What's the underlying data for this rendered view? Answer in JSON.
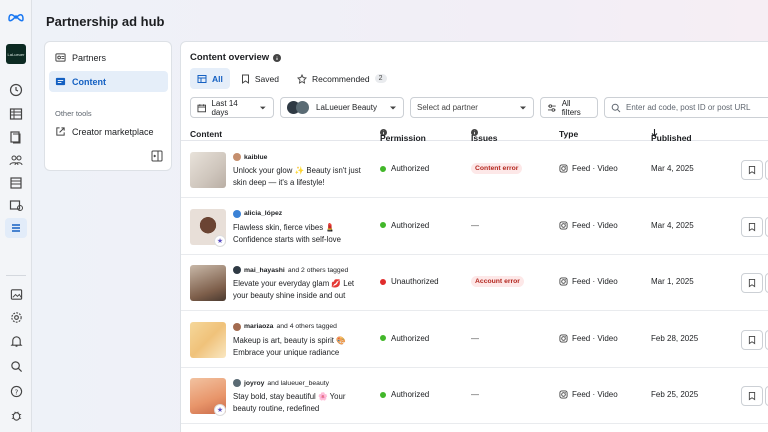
{
  "app": {
    "title": "Partnership ad hub",
    "brand_label": "LaLueuer"
  },
  "rail": {
    "icons": [
      "meta-logo",
      "brand-avatar",
      "dashboard-icon",
      "table-icon",
      "pages-icon",
      "people-icon",
      "catalog-icon",
      "ads-icon",
      "menu-icon",
      "image-icon",
      "settings-icon",
      "bell-icon",
      "search-icon",
      "help-icon",
      "bug-icon"
    ],
    "active": "menu-icon"
  },
  "left_panel": {
    "items": [
      {
        "label": "Partners",
        "icon": "partners-icon"
      },
      {
        "label": "Content",
        "icon": "content-icon",
        "active": true
      }
    ],
    "other_tools_label": "Other tools",
    "other_tools": [
      {
        "label": "Creator marketplace",
        "icon": "external-link-icon"
      }
    ]
  },
  "content": {
    "title": "Content overview",
    "tabs": [
      {
        "label": "All",
        "active": true
      },
      {
        "label": "Saved"
      },
      {
        "label": "Recommended",
        "count": "2"
      }
    ],
    "filters": {
      "date": "Last 14 days",
      "account": "LaLueuer Beauty",
      "partner_placeholder": "Select ad partner",
      "all_filters": "All filters",
      "search_placeholder": "Enter ad code, post ID or post URL"
    },
    "columns": {
      "content": "Content",
      "permission": "Permission",
      "issues": "Issues",
      "type": "Type",
      "published": "Published"
    },
    "rows": [
      {
        "author": "kaiblue",
        "tagged": "",
        "caption": "Unlock your glow ✨ Beauty isn't just skin deep — it's a lifestyle!",
        "permission": "Authorized",
        "issue": "Content error",
        "type": "Feed · Video",
        "published": "Mar 4, 2025"
      },
      {
        "author": "alicia_lópez",
        "tagged": "",
        "caption": "Flawless skin, fierce vibes 💄 Confidence starts with self-love",
        "permission": "Authorized",
        "issue": "—",
        "type": "Feed · Video",
        "published": "Mar 4, 2025"
      },
      {
        "author": "mai_hayashi",
        "tagged": "and 2 others tagged",
        "caption": "Elevate your everyday glam 💋 Let your beauty shine inside and out",
        "permission": "Unauthorized",
        "issue": "Account error",
        "type": "Feed · Video",
        "published": "Mar 1, 2025"
      },
      {
        "author": "mariaoza",
        "tagged": "and 4 others tagged",
        "caption": "Makeup is art, beauty is spirit 🎨 Embrace your unique radiance",
        "permission": "Authorized",
        "issue": "—",
        "type": "Feed · Video",
        "published": "Feb 28, 2025"
      },
      {
        "author": "joyroy",
        "tagged": "and lalueuer_beauty",
        "caption": "Stay bold, stay beautiful 🌸 Your beauty routine, redefined",
        "permission": "Authorized",
        "issue": "—",
        "type": "Feed · Video",
        "published": "Feb 25, 2025"
      }
    ]
  },
  "colors": {
    "accent": "#1460c2",
    "authorized": "#42b72a",
    "unauthorized": "#e02c2c",
    "error_bg": "#fde8e8",
    "error_text": "#b3261e"
  }
}
